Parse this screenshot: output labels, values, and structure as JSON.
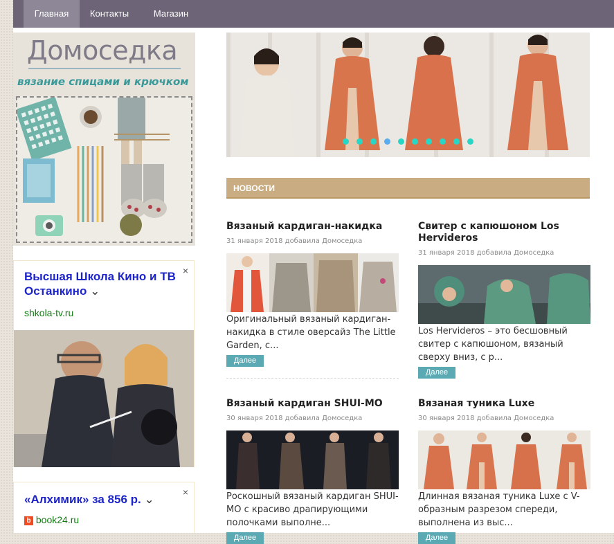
{
  "nav": {
    "items": [
      {
        "label": "Главная",
        "active": true
      },
      {
        "label": "Контакты",
        "active": false
      },
      {
        "label": "Магазин",
        "active": false
      }
    ]
  },
  "logo": {
    "title": "Домоседка",
    "subtitle": "вязание спицами и крючком"
  },
  "ads": [
    {
      "title": "Высшая Школа Кино и ТВ Останкино",
      "url": "shkola-tv.ru",
      "close": "×",
      "chevron": "⌄"
    },
    {
      "title": "«Алхимик» за 856 р.",
      "url": "book24.ru",
      "close": "×",
      "chevron": "⌄",
      "favicon": "b"
    }
  ],
  "slider": {
    "dot_count": 10,
    "active_dot": 3,
    "colors": {
      "dot": "#28d6c5",
      "active_dot": "#5aaef0"
    }
  },
  "news": {
    "heading": "НОВОСТИ",
    "more_label": "Далее",
    "posts": [
      {
        "title": "Вязаный кардиган-накидка",
        "meta": "31 января 2018 добавила Домоседка",
        "excerpt": "Оригинальный вязаный кардиган-накидка в стиле оверсайз The Little Garden, с..."
      },
      {
        "title": "Свитер с капюшоном Los Hervideros",
        "meta": "31 января 2018 добавила Домоседка",
        "excerpt": "Los Hervideros – это бесшовный свитер с капюшоном, вязаный сверху вниз, с р..."
      },
      {
        "title": "Вязаный кардиган SHUI-MO",
        "meta": "30 января 2018 добавила Домоседка",
        "excerpt": "Роскошный вязаный кардиган SHUI-MO с красиво драпирующими полочками выполне..."
      },
      {
        "title": "Вязаная туника Luxe",
        "meta": "30 января 2018 добавила Домоседка",
        "excerpt": "Длинная вязаная туника Luxe с V-образным разрезом спереди, выполнена из выс..."
      }
    ]
  },
  "colors": {
    "nav_bg": "#6d6477",
    "nav_active": "#8e8797",
    "news_header": "#c9ac82",
    "button": "#5ba9b3",
    "ad_link": "#1d24c8",
    "ad_url": "#127a12"
  }
}
